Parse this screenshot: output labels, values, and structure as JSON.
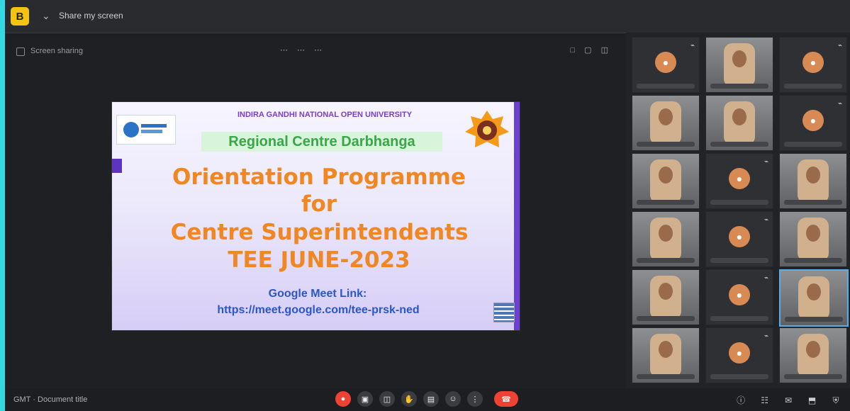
{
  "window": {
    "app_icon": "B",
    "title": "Share my screen"
  },
  "stage": {
    "share_label": "Screen sharing"
  },
  "slide": {
    "university": "INDIRA GANDHI NATIONAL OPEN UNIVERSITY",
    "regional_centre": "Regional Centre Darbhanga",
    "title_lines": [
      "Orientation Programme",
      "for",
      "Centre Superintendents",
      "TEE JUNE-2023"
    ],
    "link_label": "Google Meet Link:",
    "link_url": "https://meet.google.com/tee-prsk-ned"
  },
  "bottom": {
    "meeting_name": "GMT · Document title"
  },
  "icons": {
    "app": "app-icon",
    "back": "chevron-down-icon",
    "share": "share-icon",
    "grid": "grid-icon",
    "settings": "gear-icon",
    "mic": "mic-icon",
    "video": "video-icon",
    "leave": "phone-icon",
    "participants": "people-icon",
    "chat": "chat-icon",
    "more": "more-icon"
  },
  "colors": {
    "accent": "#f6c40f",
    "danger": "#ef4234",
    "slide_orange": "#f08722",
    "slide_blue": "#2b56c9",
    "slide_purple": "#6b3fd4"
  }
}
